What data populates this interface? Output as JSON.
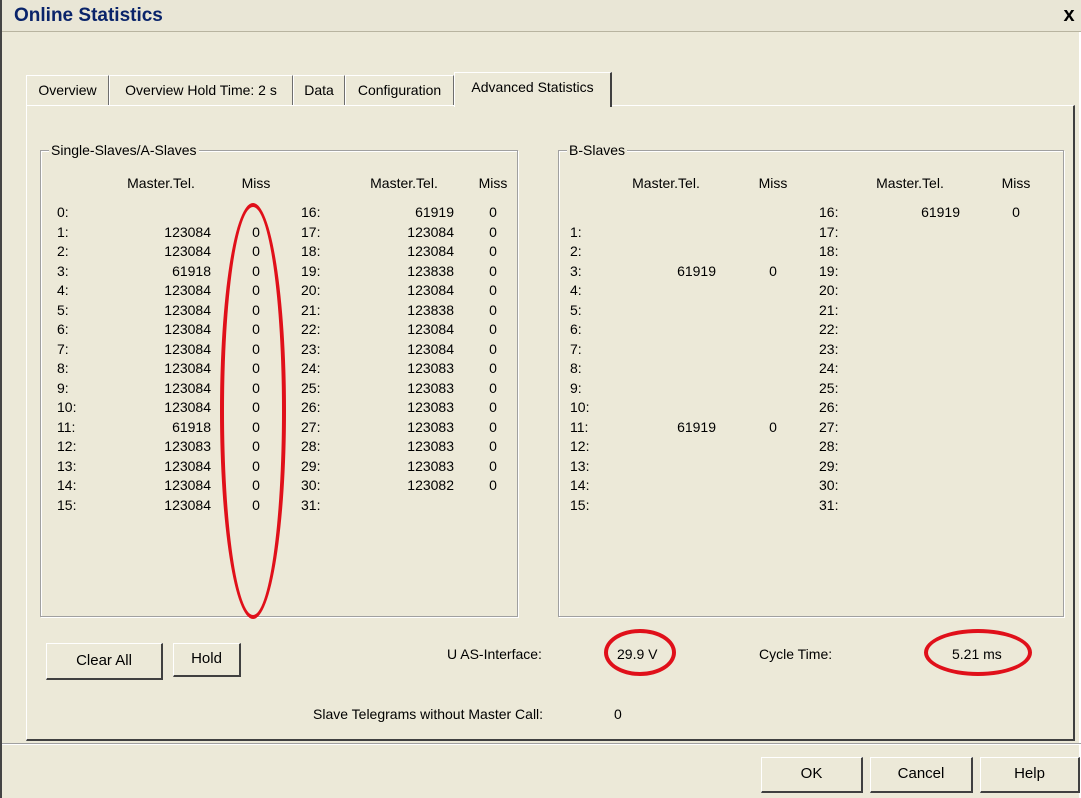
{
  "window": {
    "title": "Online Statistics",
    "close_label": "x"
  },
  "tabs": [
    {
      "label": "Overview"
    },
    {
      "label": "Overview  Hold Time: 2 s"
    },
    {
      "label": "Data"
    },
    {
      "label": "Configuration"
    },
    {
      "label": "Advanced Statistics"
    }
  ],
  "active_tab": "Advanced Statistics",
  "a_slaves": {
    "title": "Single-Slaves/A-Slaves",
    "header": {
      "master_tel": "Master.Tel.",
      "miss": "Miss"
    },
    "left": [
      {
        "id": "0:",
        "tel": "",
        "miss": ""
      },
      {
        "id": "1:",
        "tel": "123084",
        "miss": "0"
      },
      {
        "id": "2:",
        "tel": "123084",
        "miss": "0"
      },
      {
        "id": "3:",
        "tel": "61918",
        "miss": "0"
      },
      {
        "id": "4:",
        "tel": "123084",
        "miss": "0"
      },
      {
        "id": "5:",
        "tel": "123084",
        "miss": "0"
      },
      {
        "id": "6:",
        "tel": "123084",
        "miss": "0"
      },
      {
        "id": "7:",
        "tel": "123084",
        "miss": "0"
      },
      {
        "id": "8:",
        "tel": "123084",
        "miss": "0"
      },
      {
        "id": "9:",
        "tel": "123084",
        "miss": "0"
      },
      {
        "id": "10:",
        "tel": "123084",
        "miss": "0"
      },
      {
        "id": "11:",
        "tel": "61918",
        "miss": "0"
      },
      {
        "id": "12:",
        "tel": "123083",
        "miss": "0"
      },
      {
        "id": "13:",
        "tel": "123084",
        "miss": "0"
      },
      {
        "id": "14:",
        "tel": "123084",
        "miss": "0"
      },
      {
        "id": "15:",
        "tel": "123084",
        "miss": "0"
      }
    ],
    "right": [
      {
        "id": "16:",
        "tel": "61919",
        "miss": "0"
      },
      {
        "id": "17:",
        "tel": "123084",
        "miss": "0"
      },
      {
        "id": "18:",
        "tel": "123084",
        "miss": "0"
      },
      {
        "id": "19:",
        "tel": "123838",
        "miss": "0"
      },
      {
        "id": "20:",
        "tel": "123084",
        "miss": "0"
      },
      {
        "id": "21:",
        "tel": "123838",
        "miss": "0"
      },
      {
        "id": "22:",
        "tel": "123084",
        "miss": "0"
      },
      {
        "id": "23:",
        "tel": "123084",
        "miss": "0"
      },
      {
        "id": "24:",
        "tel": "123083",
        "miss": "0"
      },
      {
        "id": "25:",
        "tel": "123083",
        "miss": "0"
      },
      {
        "id": "26:",
        "tel": "123083",
        "miss": "0"
      },
      {
        "id": "27:",
        "tel": "123083",
        "miss": "0"
      },
      {
        "id": "28:",
        "tel": "123083",
        "miss": "0"
      },
      {
        "id": "29:",
        "tel": "123083",
        "miss": "0"
      },
      {
        "id": "30:",
        "tel": "123082",
        "miss": "0"
      },
      {
        "id": "31:",
        "tel": "",
        "miss": ""
      }
    ]
  },
  "b_slaves": {
    "title": "B-Slaves",
    "header": {
      "master_tel": "Master.Tel.",
      "miss": "Miss"
    },
    "left": [
      {
        "id": "",
        "tel": "",
        "miss": ""
      },
      {
        "id": "1:",
        "tel": "",
        "miss": ""
      },
      {
        "id": "2:",
        "tel": "",
        "miss": ""
      },
      {
        "id": "3:",
        "tel": "61919",
        "miss": "0"
      },
      {
        "id": "4:",
        "tel": "",
        "miss": ""
      },
      {
        "id": "5:",
        "tel": "",
        "miss": ""
      },
      {
        "id": "6:",
        "tel": "",
        "miss": ""
      },
      {
        "id": "7:",
        "tel": "",
        "miss": ""
      },
      {
        "id": "8:",
        "tel": "",
        "miss": ""
      },
      {
        "id": "9:",
        "tel": "",
        "miss": ""
      },
      {
        "id": "10:",
        "tel": "",
        "miss": ""
      },
      {
        "id": "11:",
        "tel": "61919",
        "miss": "0"
      },
      {
        "id": "12:",
        "tel": "",
        "miss": ""
      },
      {
        "id": "13:",
        "tel": "",
        "miss": ""
      },
      {
        "id": "14:",
        "tel": "",
        "miss": ""
      },
      {
        "id": "15:",
        "tel": "",
        "miss": ""
      }
    ],
    "right": [
      {
        "id": "16:",
        "tel": "61919",
        "miss": "0"
      },
      {
        "id": "17:",
        "tel": "",
        "miss": ""
      },
      {
        "id": "18:",
        "tel": "",
        "miss": ""
      },
      {
        "id": "19:",
        "tel": "",
        "miss": ""
      },
      {
        "id": "20:",
        "tel": "",
        "miss": ""
      },
      {
        "id": "21:",
        "tel": "",
        "miss": ""
      },
      {
        "id": "22:",
        "tel": "",
        "miss": ""
      },
      {
        "id": "23:",
        "tel": "",
        "miss": ""
      },
      {
        "id": "24:",
        "tel": "",
        "miss": ""
      },
      {
        "id": "25:",
        "tel": "",
        "miss": ""
      },
      {
        "id": "26:",
        "tel": "",
        "miss": ""
      },
      {
        "id": "27:",
        "tel": "",
        "miss": ""
      },
      {
        "id": "28:",
        "tel": "",
        "miss": ""
      },
      {
        "id": "29:",
        "tel": "",
        "miss": ""
      },
      {
        "id": "30:",
        "tel": "",
        "miss": ""
      },
      {
        "id": "31:",
        "tel": "",
        "miss": ""
      }
    ]
  },
  "buttons": {
    "clear_all": "Clear All",
    "hold": "Hold",
    "ok": "OK",
    "cancel": "Cancel",
    "help": "Help"
  },
  "status": {
    "u_as_label": "U AS-Interface:",
    "u_as_value": "29.9 V",
    "cycle_label": "Cycle Time:",
    "cycle_value": "5.21 ms",
    "slave_tel_label": "Slave Telegrams without Master Call:",
    "slave_tel_value": "0"
  },
  "colors": {
    "highlight_ellipse": "#e0101a",
    "title_text": "#0a246a",
    "dialog_bg": "#ece9d8"
  }
}
